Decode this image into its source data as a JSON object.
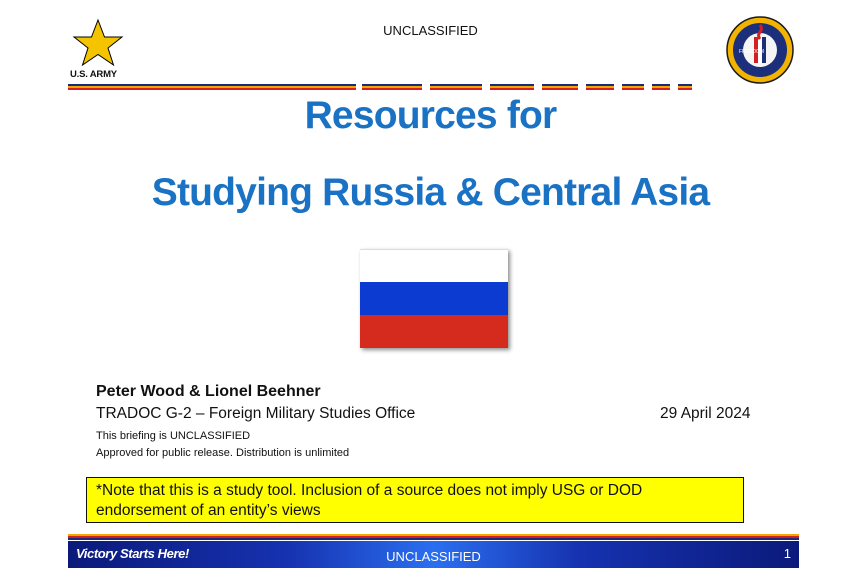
{
  "header": {
    "army_label": "U.S. ARMY",
    "classification": "UNCLASSIFIED",
    "seal_icon": "tradoc-seal-icon",
    "star_icon": "army-star-icon"
  },
  "title": {
    "line1": "Resources for",
    "line2": "Studying Russia & Central Asia"
  },
  "flag": {
    "name": "russia-flag-icon",
    "colors": [
      "#ffffff",
      "#0c3bd1",
      "#d52b1e"
    ]
  },
  "byline": {
    "authors": "Peter Wood & Lionel Beehner",
    "organization": "TRADOC G-2 – Foreign Military Studies Office",
    "date": "29 April 2024",
    "briefing_class": "This briefing is UNCLASSIFIED",
    "release": "Approved for public release. Distribution is unlimited"
  },
  "note": "*Note that this is a study tool. Inclusion of a source does not imply USG or DOD endorsement of an entity’s views",
  "footer": {
    "slogan": "Victory Starts Here!",
    "classification": "UNCLASSIFIED",
    "page_number": "1"
  },
  "colors": {
    "title_blue": "#1a72c4",
    "note_yellow": "#ffff00",
    "stripe_gold": "#f0a800",
    "stripe_red": "#d42020",
    "stripe_navy": "#1a2a7a"
  }
}
